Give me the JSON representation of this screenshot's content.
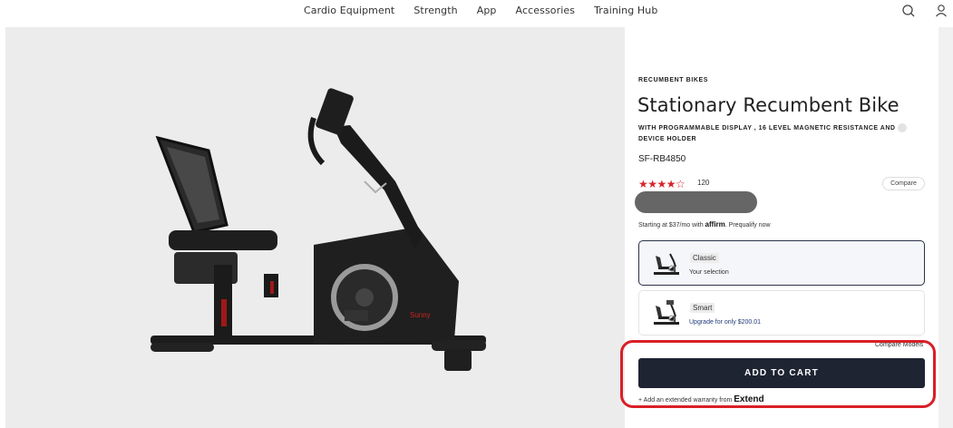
{
  "nav": {
    "items": [
      "Cardio Equipment",
      "Strength",
      "App",
      "Accessories",
      "Training Hub"
    ],
    "icons": [
      "search-icon",
      "user-icon"
    ]
  },
  "product": {
    "category": "RECUMBENT BIKES",
    "title": "Stationary Recumbent Bike",
    "subtitle": "WITH PROGRAMMABLE DISPLAY , 16 LEVEL MAGNETIC RESISTANCE AND DEVICE HOLDER",
    "sku": "SF-RB4850",
    "rating": 4.5,
    "stars": "★★★★☆",
    "review_count": "120",
    "compare_label": "Compare",
    "financing_prefix": "Starting at $37/mo with",
    "financing_brand": "affirm",
    "financing_suffix": ". Prequalify now"
  },
  "variants": [
    {
      "name": "Classic",
      "sub": "Your selection",
      "selected": true
    },
    {
      "name": "Smart",
      "sub": "Upgrade for only $200.01",
      "selected": false
    }
  ],
  "compare_models": "Compare Models",
  "cart": {
    "label": "ADD TO CART",
    "warranty_prefix": "+ Add an extended warranty from",
    "warranty_brand": "Extend"
  },
  "colors": {
    "accent_red": "#d91f26",
    "cart_bg": "#1f2433",
    "star": "#d8232a"
  }
}
